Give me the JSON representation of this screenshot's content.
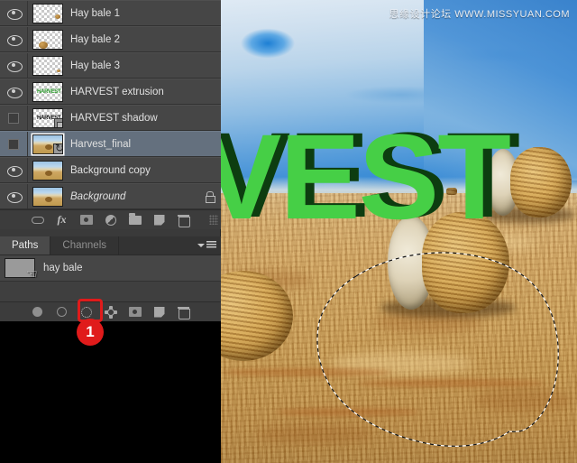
{
  "watermark": "思缘设计论坛 WWW.MISSYUAN.COM",
  "canvas": {
    "artwork_text": "VEST",
    "artwork_full_word": "HARVEST",
    "face_color": "#46cf46",
    "extrusion_color": "#0d3d10"
  },
  "layers_panel": {
    "rows": [
      {
        "name": "Hay bale 1",
        "visible": true,
        "thumb": "transparent",
        "italic": false,
        "selected": false,
        "locked": false,
        "badge": ""
      },
      {
        "name": "Hay bale 2",
        "visible": true,
        "thumb": "transparent",
        "italic": false,
        "selected": false,
        "locked": false,
        "badge": ""
      },
      {
        "name": "Hay bale 3",
        "visible": true,
        "thumb": "transparent",
        "italic": false,
        "selected": false,
        "locked": false,
        "badge": ""
      },
      {
        "name": "HARVEST extrusion",
        "visible": true,
        "thumb": "text-green",
        "italic": false,
        "selected": false,
        "locked": false,
        "badge": ""
      },
      {
        "name": "HARVEST shadow",
        "visible": false,
        "thumb": "text-dark",
        "italic": false,
        "selected": false,
        "locked": false,
        "badge": "3d"
      },
      {
        "name": "Harvest_final",
        "visible": false,
        "thumb": "photo",
        "italic": false,
        "selected": true,
        "locked": false,
        "badge": "smart"
      },
      {
        "name": "Background copy",
        "visible": true,
        "thumb": "photo",
        "italic": false,
        "selected": false,
        "locked": false,
        "badge": ""
      },
      {
        "name": "Background",
        "visible": true,
        "thumb": "photo",
        "italic": true,
        "selected": false,
        "locked": true,
        "badge": ""
      }
    ],
    "toolbar": [
      {
        "icon": "link-icon",
        "label": "Link layers"
      },
      {
        "icon": "fx-icon",
        "label": "Add a layer style"
      },
      {
        "icon": "layer-mask-icon",
        "label": "Add layer mask"
      },
      {
        "icon": "adjustment-icon",
        "label": "Create new fill or adjustment layer"
      },
      {
        "icon": "folder-icon",
        "label": "Create a new group"
      },
      {
        "icon": "new-layer-icon",
        "label": "Create a new layer"
      },
      {
        "icon": "trash-icon",
        "label": "Delete layer"
      }
    ]
  },
  "paths_panel": {
    "tabs": [
      {
        "label": "Paths",
        "active": true
      },
      {
        "label": "Channels",
        "active": false
      }
    ],
    "rows": [
      {
        "name": "hay bale"
      }
    ],
    "toolbar": [
      {
        "icon": "fill-path-icon",
        "label": "Fill path with foreground color",
        "highlighted": false
      },
      {
        "icon": "stroke-path-icon",
        "label": "Stroke path with brush",
        "highlighted": false
      },
      {
        "icon": "load-selection-icon",
        "label": "Load path as a selection",
        "highlighted": true
      },
      {
        "icon": "make-work-path-icon",
        "label": "Make work path from selection",
        "highlighted": false
      },
      {
        "icon": "path-mask-icon",
        "label": "Add layer mask",
        "highlighted": false
      },
      {
        "icon": "new-path-icon",
        "label": "Create new path",
        "highlighted": false
      },
      {
        "icon": "delete-path-icon",
        "label": "Delete current path",
        "highlighted": false
      }
    ]
  },
  "annotation": {
    "step_number": "1",
    "color": "#e01b1b",
    "target": "load-selection-icon"
  }
}
